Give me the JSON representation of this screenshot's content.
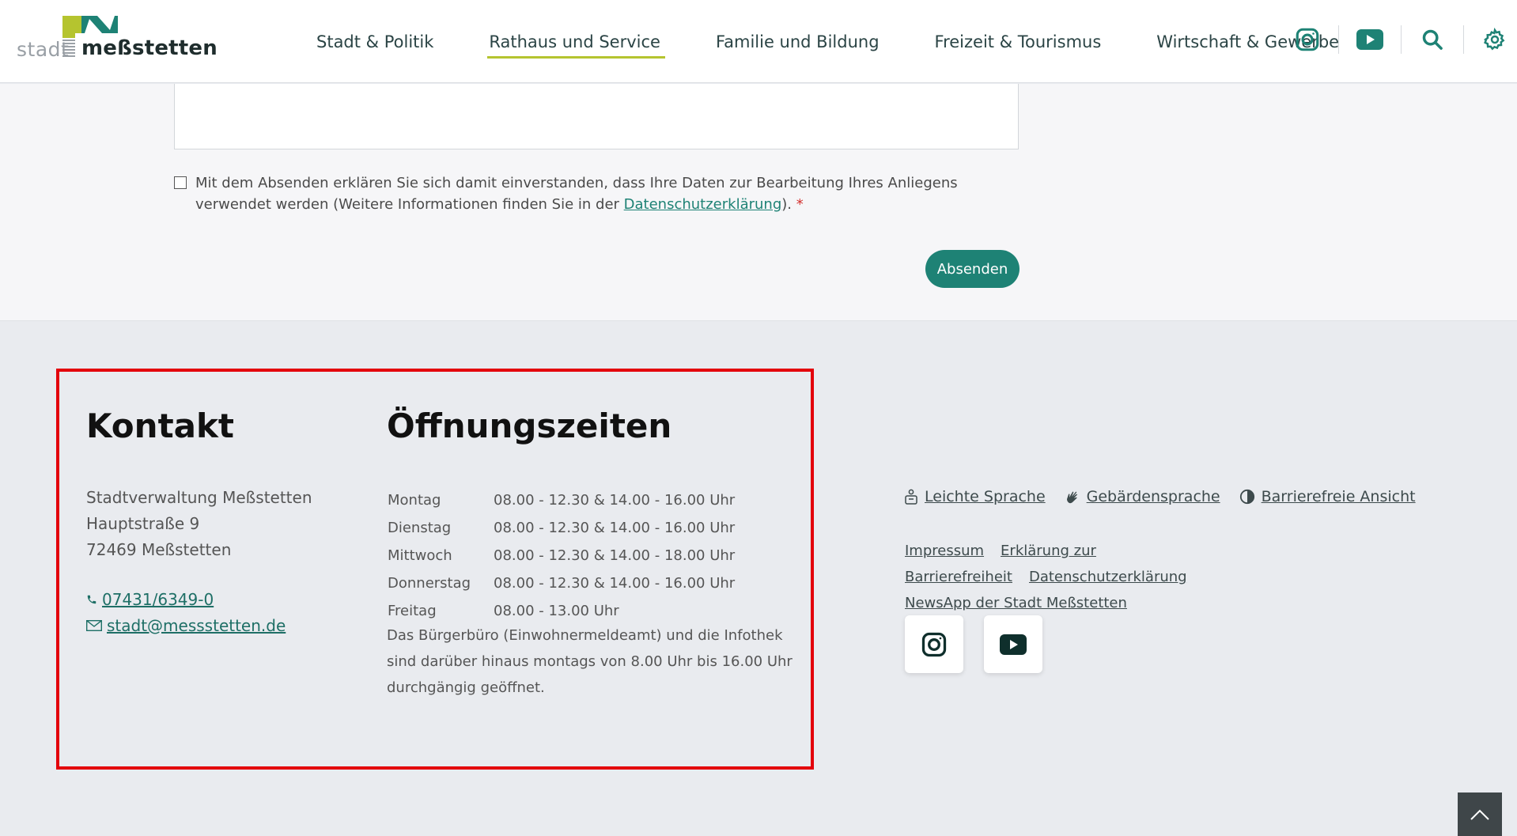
{
  "header": {
    "logo": {
      "prefix": "stadt",
      "name": "meßstetten"
    },
    "nav": [
      {
        "label": "Stadt & Politik",
        "active": false
      },
      {
        "label": "Rathaus und Service",
        "active": true
      },
      {
        "label": "Familie und Bildung",
        "active": false
      },
      {
        "label": "Freizeit & Tourismus",
        "active": false
      },
      {
        "label": "Wirtschaft & Gewerbe",
        "active": false
      }
    ],
    "icons": [
      "instagram-icon",
      "youtube-icon",
      "search-icon",
      "gear-icon"
    ]
  },
  "form": {
    "consent_text": "Mit dem Absenden erklären Sie sich damit einverstanden, dass Ihre Daten zur Bearbeitung Ihres Anliegens verwendet werden (Weitere Informationen finden Sie in der ",
    "consent_link": "Datenschutzerklärung",
    "consent_after": ").",
    "required_mark": "*",
    "submit_label": "Absenden"
  },
  "footer": {
    "contact": {
      "heading": "Kontakt",
      "address": [
        "Stadtverwaltung Meßstetten",
        "Hauptstraße 9",
        "72469 Meßstetten"
      ],
      "phone": "07431/6349-0",
      "email": "stadt@messstetten.de"
    },
    "hours": {
      "heading": "Öffnungszeiten",
      "rows": [
        {
          "day": "Montag",
          "time": "08.00 - 12.30 & 14.00 - 16.00 Uhr"
        },
        {
          "day": "Dienstag",
          "time": "08.00 - 12.30 & 14.00 - 16.00 Uhr"
        },
        {
          "day": "Mittwoch",
          "time": "08.00 - 12.30 & 14.00 - 18.00 Uhr"
        },
        {
          "day": "Donnerstag",
          "time": "08.00 - 12.30 & 14.00 - 16.00 Uhr"
        },
        {
          "day": "Freitag",
          "time": "08.00 - 13.00 Uhr"
        }
      ],
      "note": "Das Bürgerbüro (Einwohnermeldeamt) und die Infothek sind darüber hinaus montags von 8.00 Uhr bis 16.00 Uhr durchgängig geöffnet."
    },
    "accessibility": [
      {
        "label": "Leichte Sprache",
        "icon": "easy-language-icon"
      },
      {
        "label": "Gebärdensprache",
        "icon": "sign-language-icon"
      },
      {
        "label": "Barrierefreie Ansicht",
        "icon": "contrast-icon"
      }
    ],
    "legal": [
      "Impressum",
      "Erklärung zur Barrierefreiheit",
      "Datenschutzerklärung",
      "NewsApp der Stadt Meßstetten"
    ],
    "social": [
      "instagram-icon",
      "youtube-icon"
    ]
  },
  "colors": {
    "accent": "#1e8275",
    "nav_underline": "#b5c42f",
    "highlight": "#e3000b",
    "required": "#d3302e"
  }
}
